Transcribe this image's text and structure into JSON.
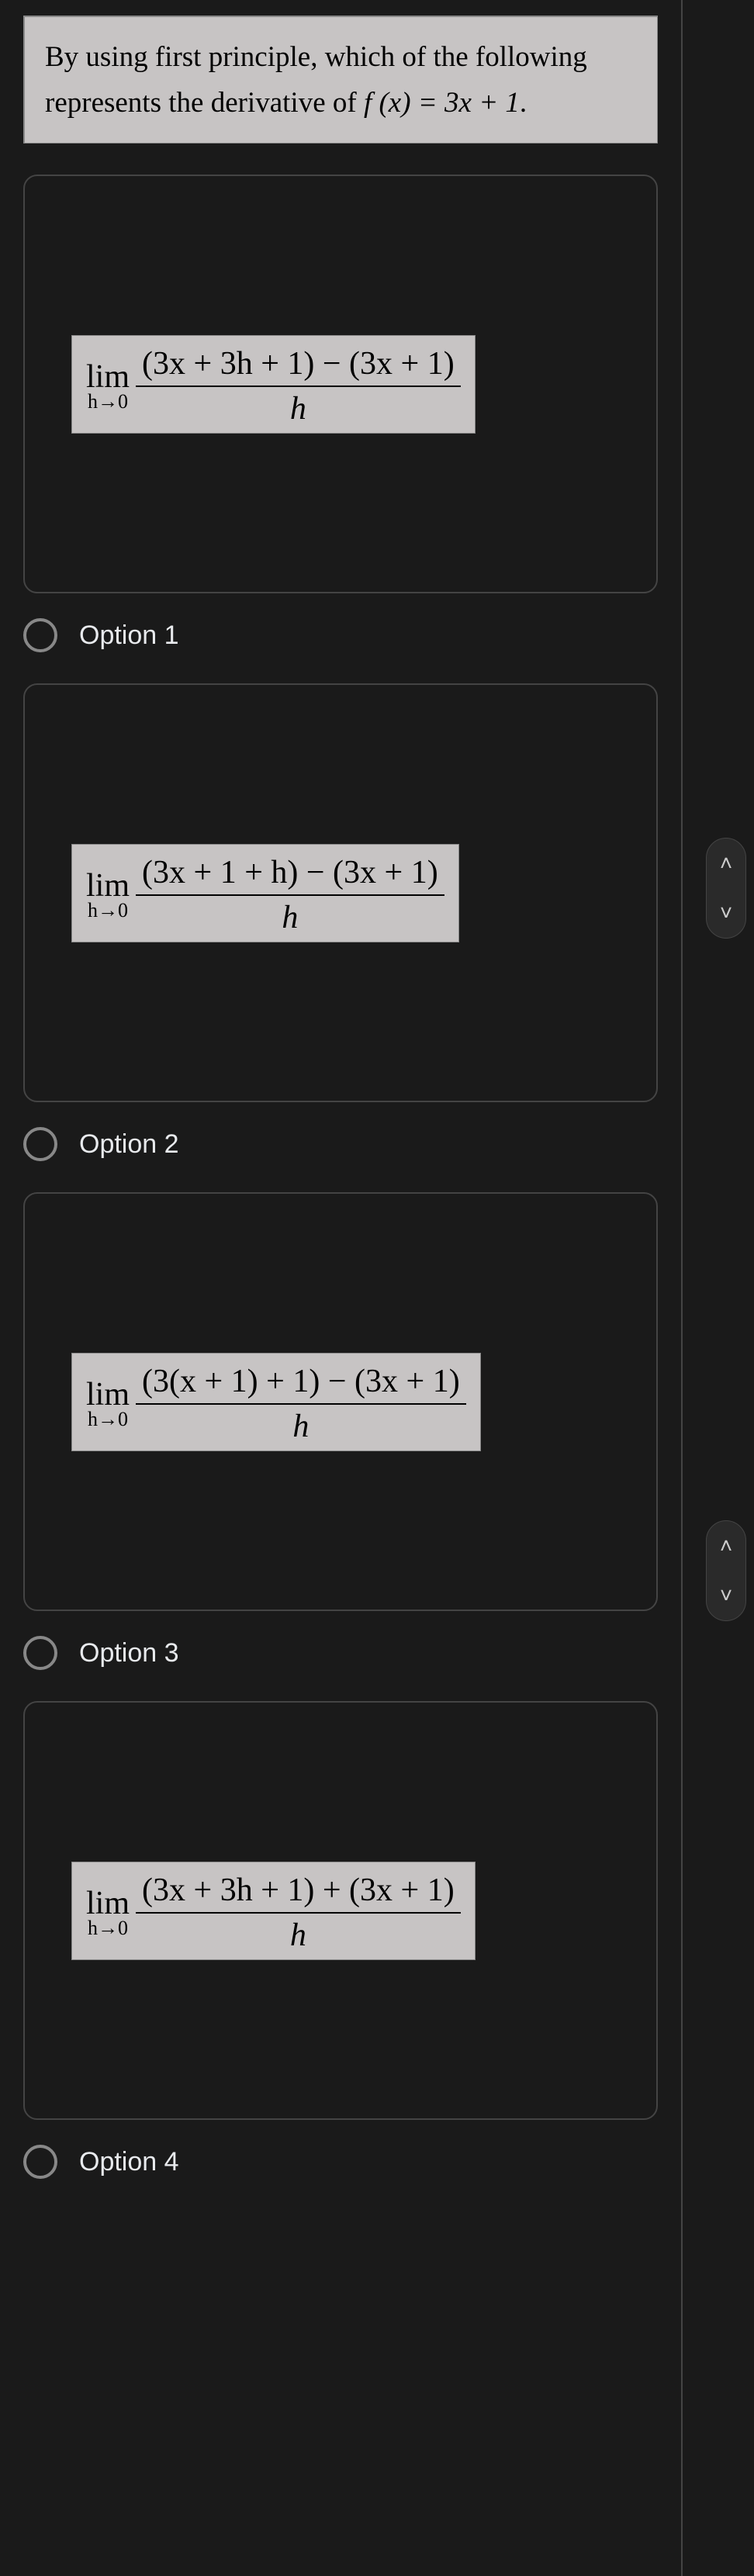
{
  "question": {
    "line1": "By using first principle, which of the following",
    "line2_a": "represents the derivative of ",
    "line2_b": "f (x) = 3x + 1",
    "line2_c": "."
  },
  "options": {
    "opt1": {
      "numerator": "(3x + 3h + 1) − (3x + 1)",
      "denominator": "h",
      "label": "Option 1"
    },
    "opt2": {
      "numerator": "(3x + 1 + h) − (3x + 1)",
      "denominator": "h",
      "label": "Option 2"
    },
    "opt3": {
      "numerator": "(3(x + 1) + 1) − (3x + 1)",
      "denominator": "h",
      "label": "Option 3"
    },
    "opt4": {
      "numerator": "(3x + 3h + 1) + (3x + 1)",
      "denominator": "h",
      "label": "Option 4"
    }
  },
  "lim": {
    "top": "lim",
    "bot": "h→0"
  },
  "nav": {
    "up": "˄",
    "down": "˅"
  }
}
